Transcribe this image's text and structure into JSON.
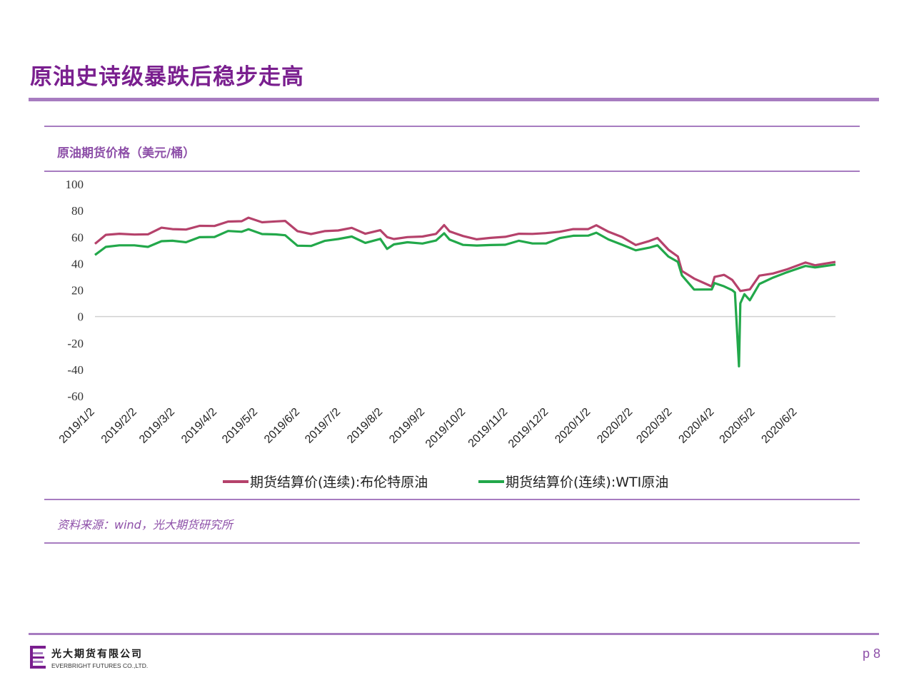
{
  "slide": {
    "title": "原油史诗级暴跌后稳步走高",
    "chart_heading": "原油期货价格（美元/桶）",
    "source": "资料来源：wind，光大期货研究所",
    "company_cn": "光大期货有限公司",
    "company_en": "EVERBRIGHT FUTURES CO.,LTD.",
    "page_number": "p 8",
    "accent_color": "#a77cc0"
  },
  "chart_data": {
    "type": "line",
    "title": "原油期货价格（美元/桶）",
    "xlabel": "",
    "ylabel": "",
    "ylim": [
      -60,
      100
    ],
    "yticks": [
      100,
      80,
      60,
      40,
      20,
      0,
      -20,
      -40,
      -60
    ],
    "xticks": [
      "2019/1/2",
      "2019/2/2",
      "2019/3/2",
      "2019/4/2",
      "2019/5/2",
      "2019/6/2",
      "2019/7/2",
      "2019/8/2",
      "2019/9/2",
      "2019/10/2",
      "2019/11/2",
      "2019/12/2",
      "2020/1/2",
      "2020/2/2",
      "2020/3/2",
      "2020/4/2",
      "2020/5/2",
      "2020/6/2"
    ],
    "grid": false,
    "legend": "bottom",
    "series": [
      {
        "name": "期货结算价(连续):布伦特原油",
        "color": "#b5426b",
        "points": [
          [
            "2019-01-02",
            54.9
          ],
          [
            "2019-01-10",
            61.7
          ],
          [
            "2019-01-20",
            62.5
          ],
          [
            "2019-01-31",
            61.9
          ],
          [
            "2019-02-10",
            62.1
          ],
          [
            "2019-02-20",
            67.1
          ],
          [
            "2019-02-28",
            66.0
          ],
          [
            "2019-03-10",
            65.7
          ],
          [
            "2019-03-20",
            68.5
          ],
          [
            "2019-03-31",
            68.4
          ],
          [
            "2019-04-10",
            71.7
          ],
          [
            "2019-04-20",
            72.0
          ],
          [
            "2019-04-25",
            74.6
          ],
          [
            "2019-05-05",
            71.2
          ],
          [
            "2019-05-15",
            71.8
          ],
          [
            "2019-05-22",
            72.2
          ],
          [
            "2019-05-31",
            64.5
          ],
          [
            "2019-06-10",
            62.3
          ],
          [
            "2019-06-20",
            64.5
          ],
          [
            "2019-06-30",
            65.0
          ],
          [
            "2019-07-10",
            67.0
          ],
          [
            "2019-07-20",
            62.5
          ],
          [
            "2019-07-31",
            65.2
          ],
          [
            "2019-08-05",
            60.0
          ],
          [
            "2019-08-10",
            58.5
          ],
          [
            "2019-08-20",
            60.0
          ],
          [
            "2019-08-31",
            60.4
          ],
          [
            "2019-09-10",
            62.4
          ],
          [
            "2019-09-16",
            69.0
          ],
          [
            "2019-09-20",
            64.3
          ],
          [
            "2019-09-30",
            60.8
          ],
          [
            "2019-10-10",
            58.3
          ],
          [
            "2019-10-20",
            59.4
          ],
          [
            "2019-10-31",
            60.2
          ],
          [
            "2019-11-10",
            62.5
          ],
          [
            "2019-11-20",
            62.4
          ],
          [
            "2019-11-30",
            63.0
          ],
          [
            "2019-12-10",
            64.0
          ],
          [
            "2019-12-20",
            66.0
          ],
          [
            "2019-12-31",
            66.0
          ],
          [
            "2020-01-06",
            68.9
          ],
          [
            "2020-01-15",
            64.0
          ],
          [
            "2020-01-25",
            60.0
          ],
          [
            "2020-02-04",
            54.0
          ],
          [
            "2020-02-14",
            57.0
          ],
          [
            "2020-02-20",
            59.3
          ],
          [
            "2020-02-28",
            50.5
          ],
          [
            "2020-03-06",
            45.3
          ],
          [
            "2020-03-09",
            34.4
          ],
          [
            "2020-03-18",
            28.7
          ],
          [
            "2020-03-31",
            22.7
          ],
          [
            "2020-04-02",
            29.9
          ],
          [
            "2020-04-09",
            31.5
          ],
          [
            "2020-04-15",
            27.7
          ],
          [
            "2020-04-21",
            19.3
          ],
          [
            "2020-04-28",
            20.5
          ],
          [
            "2020-05-05",
            30.9
          ],
          [
            "2020-05-15",
            32.5
          ],
          [
            "2020-05-25",
            35.5
          ],
          [
            "2020-06-08",
            40.8
          ],
          [
            "2020-06-15",
            38.7
          ],
          [
            "2020-06-30",
            41.2
          ]
        ]
      },
      {
        "name": "期货结算价(连续):WTI原油",
        "color": "#22a84a",
        "points": [
          [
            "2019-01-02",
            46.5
          ],
          [
            "2019-01-10",
            52.6
          ],
          [
            "2019-01-20",
            53.8
          ],
          [
            "2019-01-31",
            53.8
          ],
          [
            "2019-02-10",
            52.6
          ],
          [
            "2019-02-20",
            56.9
          ],
          [
            "2019-02-28",
            57.2
          ],
          [
            "2019-03-10",
            56.1
          ],
          [
            "2019-03-20",
            59.9
          ],
          [
            "2019-03-31",
            60.1
          ],
          [
            "2019-04-10",
            64.6
          ],
          [
            "2019-04-20",
            64.0
          ],
          [
            "2019-04-25",
            65.9
          ],
          [
            "2019-05-05",
            62.3
          ],
          [
            "2019-05-15",
            62.0
          ],
          [
            "2019-05-22",
            61.4
          ],
          [
            "2019-05-31",
            53.5
          ],
          [
            "2019-06-10",
            53.3
          ],
          [
            "2019-06-20",
            57.1
          ],
          [
            "2019-06-30",
            58.5
          ],
          [
            "2019-07-10",
            60.4
          ],
          [
            "2019-07-20",
            55.6
          ],
          [
            "2019-07-31",
            58.6
          ],
          [
            "2019-08-05",
            51.1
          ],
          [
            "2019-08-10",
            54.5
          ],
          [
            "2019-08-20",
            56.1
          ],
          [
            "2019-08-31",
            55.1
          ],
          [
            "2019-09-10",
            57.4
          ],
          [
            "2019-09-16",
            62.9
          ],
          [
            "2019-09-20",
            58.1
          ],
          [
            "2019-09-30",
            54.1
          ],
          [
            "2019-10-10",
            53.6
          ],
          [
            "2019-10-20",
            54.0
          ],
          [
            "2019-10-31",
            54.2
          ],
          [
            "2019-11-10",
            57.2
          ],
          [
            "2019-11-20",
            55.2
          ],
          [
            "2019-11-30",
            55.2
          ],
          [
            "2019-12-10",
            59.2
          ],
          [
            "2019-12-20",
            61.0
          ],
          [
            "2019-12-31",
            61.1
          ],
          [
            "2020-01-06",
            63.3
          ],
          [
            "2020-01-15",
            58.2
          ],
          [
            "2020-01-25",
            54.2
          ],
          [
            "2020-02-04",
            50.0
          ],
          [
            "2020-02-14",
            52.0
          ],
          [
            "2020-02-20",
            53.8
          ],
          [
            "2020-02-28",
            45.3
          ],
          [
            "2020-03-06",
            41.3
          ],
          [
            "2020-03-09",
            31.1
          ],
          [
            "2020-03-18",
            20.4
          ],
          [
            "2020-03-31",
            20.5
          ],
          [
            "2020-04-02",
            25.3
          ],
          [
            "2020-04-09",
            22.8
          ],
          [
            "2020-04-15",
            19.9
          ],
          [
            "2020-04-17",
            18.3
          ],
          [
            "2020-04-20",
            -37.6
          ],
          [
            "2020-04-21",
            10.0
          ],
          [
            "2020-04-24",
            16.9
          ],
          [
            "2020-04-28",
            12.3
          ],
          [
            "2020-05-05",
            24.6
          ],
          [
            "2020-05-15",
            29.4
          ],
          [
            "2020-05-25",
            33.3
          ],
          [
            "2020-06-08",
            38.2
          ],
          [
            "2020-06-15",
            37.1
          ],
          [
            "2020-06-30",
            39.3
          ]
        ]
      }
    ]
  }
}
